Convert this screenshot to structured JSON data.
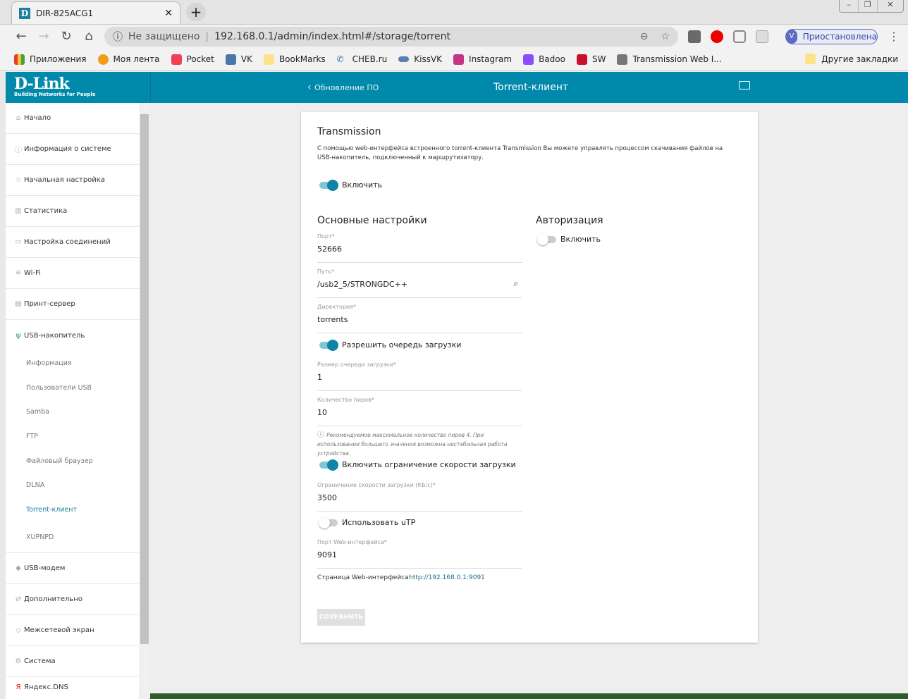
{
  "browser": {
    "tab_title": "DIR-825ACG1",
    "security": "Не защищено",
    "url": "192.168.0.1/admin/index.html#/storage/torrent",
    "profile_initial": "V",
    "profile_status": "Приостановлена",
    "bookmarks": [
      "Приложения",
      "Моя лента",
      "Pocket",
      "VK",
      "BookMarks",
      "CHEB.ru",
      "KissVK",
      "Instagram",
      "Badoo",
      "SW",
      "Transmission Web I..."
    ],
    "other_bookmarks": "Другие закладки"
  },
  "header": {
    "logo": "D-Link",
    "logo_tagline": "Building Networks for People",
    "back_label": "Обновление ПО",
    "title": "Torrent-клиент"
  },
  "sidebar": {
    "items": [
      "Начало",
      "Информация о системе",
      "Начальная настройка",
      "Статистика",
      "Настройка соединений",
      "Wi-Fi",
      "Принт-сервер",
      "USB-накопитель"
    ],
    "sub_items": [
      "Информация",
      "Пользователи USB",
      "Samba",
      "FTP",
      "Файловый браузер",
      "DLNA",
      "Torrent-клиент",
      "XUPNPD"
    ],
    "items_after": [
      "USB-модем",
      "Дополнительно",
      "Межсетевой экран",
      "Система",
      "Яндекс.DNS"
    ]
  },
  "main": {
    "title": "Transmission",
    "description": "С помощью web-интерфейса встроенного torrent-клиента Transmission Вы можете управлять процессом скачивания файлов на USB-накопитель, подключенный к маршрутизатору.",
    "enable_label": "Включить",
    "enable_on": true,
    "basic_title": "Основные настройки",
    "auth_title": "Авторизация",
    "auth_enable_label": "Включить",
    "auth_on": false,
    "port_label": "Порт",
    "port": "52666",
    "path_label": "Путь",
    "path": "/usb2_5/STRONGDC++",
    "dir_label": "Директория",
    "dir": "torrents",
    "queue_label": "Разрешить очередь загрузки",
    "queue_on": true,
    "queue_size_label": "Размер очереди загрузки",
    "queue_size": "1",
    "peers_label": "Количество пиров",
    "peers": "10",
    "peers_hint": "Рекомендуемое максимальное количество пиров 4. При использовании большего значения возможна нестабильная работа устройства.",
    "speed_limit_label": "Включить ограничение скорости загрузки",
    "speed_on": true,
    "speed_value_label": "Ограничение скорости загрузки (КБ/с)",
    "speed_value": "3500",
    "utp_label": "Использовать uTP",
    "utp_on": false,
    "web_port_label": "Порт Web-интерфейса",
    "web_port": "9091",
    "web_page_label": "Страница Web-интерфейса:",
    "web_page_link": "http://192.168.0.1:9091",
    "save_label": "СОХРАНИТЬ",
    "required_mark": "*"
  }
}
